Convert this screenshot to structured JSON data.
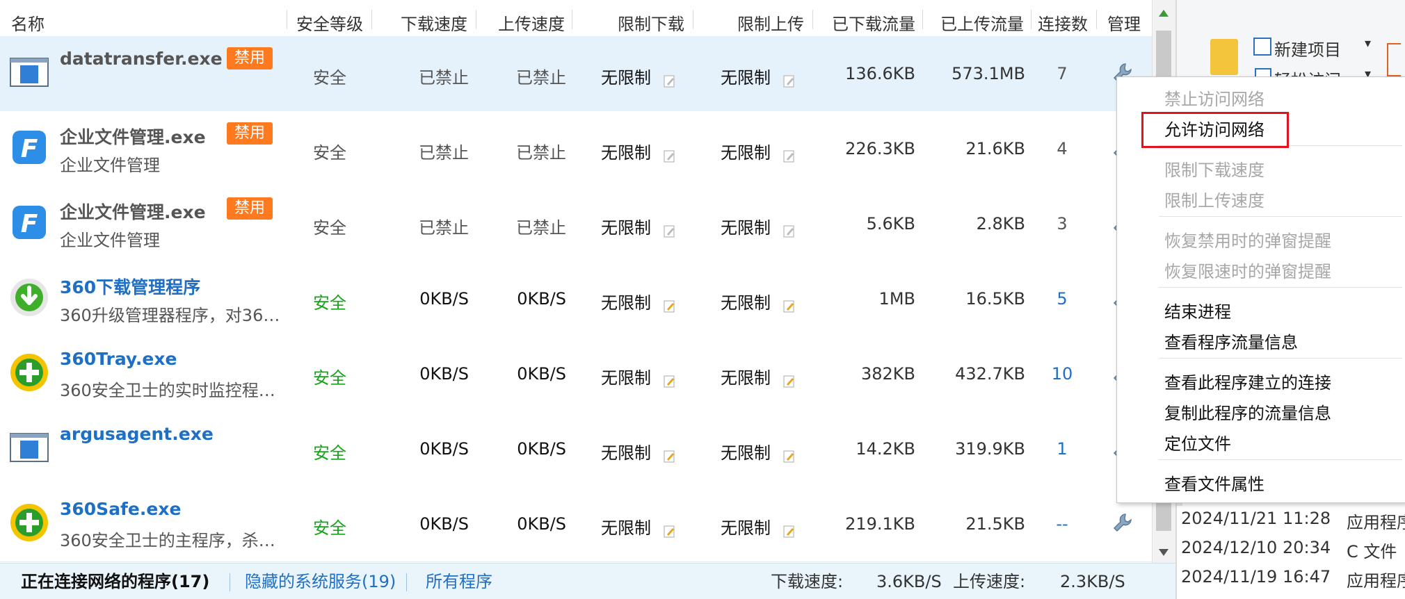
{
  "columns": [
    "名称",
    "安全等级",
    "下载速度",
    "上传速度",
    "限制下载",
    "限制上传",
    "已下载流量",
    "已上传流量",
    "连接数",
    "管理"
  ],
  "rows": [
    {
      "name": "datatransfer.exe",
      "desc": "",
      "badge": "禁用",
      "icon": "window-app-icon",
      "name_color": "gray",
      "security": "安全",
      "security_color": "gray",
      "down_speed": "已禁止",
      "up_speed": "已禁止",
      "limit_down": "无限制",
      "limit_up": "无限制",
      "downloaded": "136.6KB",
      "uploaded": "573.1MB",
      "connections": "7",
      "selected": true
    },
    {
      "name": "企业文件管理.exe",
      "desc": "企业文件管理",
      "badge": "禁用",
      "icon": "blue-f-app-icon",
      "name_color": "gray",
      "security": "安全",
      "security_color": "gray",
      "down_speed": "已禁止",
      "up_speed": "已禁止",
      "limit_down": "无限制",
      "limit_up": "无限制",
      "downloaded": "226.3KB",
      "uploaded": "21.6KB",
      "connections": "4",
      "selected": false
    },
    {
      "name": "企业文件管理.exe",
      "desc": "企业文件管理",
      "badge": "禁用",
      "icon": "blue-f-app-icon",
      "name_color": "gray",
      "security": "安全",
      "security_color": "gray",
      "down_speed": "已禁止",
      "up_speed": "已禁止",
      "limit_down": "无限制",
      "limit_up": "无限制",
      "downloaded": "5.6KB",
      "uploaded": "2.8KB",
      "connections": "3",
      "selected": false
    },
    {
      "name": "360下载管理程序",
      "desc": "360升级管理器程序，对36…",
      "badge": "",
      "icon": "green-download-icon",
      "name_color": "blue",
      "security": "安全",
      "security_color": "green",
      "down_speed": "0KB/S",
      "up_speed": "0KB/S",
      "limit_down": "无限制",
      "limit_up": "无限制",
      "downloaded": "1MB",
      "uploaded": "16.5KB",
      "connections": "5",
      "selected": false
    },
    {
      "name": "360Tray.exe",
      "desc": "360安全卫士的实时监控程…",
      "badge": "",
      "icon": "360-plus-icon",
      "name_color": "blue",
      "security": "安全",
      "security_color": "green",
      "down_speed": "0KB/S",
      "up_speed": "0KB/S",
      "limit_down": "无限制",
      "limit_up": "无限制",
      "downloaded": "382KB",
      "uploaded": "432.7KB",
      "connections": "10",
      "selected": false
    },
    {
      "name": "argusagent.exe",
      "desc": "",
      "badge": "",
      "icon": "window-app-icon",
      "name_color": "blue",
      "security": "安全",
      "security_color": "green",
      "down_speed": "0KB/S",
      "up_speed": "0KB/S",
      "limit_down": "无限制",
      "limit_up": "无限制",
      "downloaded": "14.2KB",
      "uploaded": "319.9KB",
      "connections": "1",
      "selected": false
    },
    {
      "name": "360Safe.exe",
      "desc": "360安全卫士的主程序，杀…",
      "badge": "",
      "icon": "360-plus-icon",
      "name_color": "blue",
      "security": "安全",
      "security_color": "green",
      "down_speed": "0KB/S",
      "up_speed": "0KB/S",
      "limit_down": "无限制",
      "limit_up": "无限制",
      "downloaded": "219.1KB",
      "uploaded": "21.5KB",
      "connections": "--",
      "selected": false
    }
  ],
  "footer": {
    "tab_connecting": "正在连接网络的程序(17)",
    "tab_hidden": "隐藏的系统服务(19)",
    "tab_all": "所有程序",
    "download_label": "下载速度:",
    "download_value": "3.6KB/S",
    "upload_label": "上传速度:",
    "upload_value": "2.3KB/S"
  },
  "context_menu": [
    {
      "label": "禁止访问网络",
      "enabled": false
    },
    {
      "label": "允许访问网络",
      "enabled": true,
      "highlighted": true
    },
    {
      "label": "限制下载速度",
      "enabled": false
    },
    {
      "label": "限制上传速度",
      "enabled": false
    },
    {
      "label": "恢复禁用时的弹窗提醒",
      "enabled": false
    },
    {
      "label": "恢复限速时的弹窗提醒",
      "enabled": false
    },
    {
      "label": "结束进程",
      "enabled": true
    },
    {
      "label": "查看程序流量信息",
      "enabled": true
    },
    {
      "label": "查看此程序建立的连接",
      "enabled": true
    },
    {
      "label": "复制此程序的流量信息",
      "enabled": true
    },
    {
      "label": "定位文件",
      "enabled": true
    },
    {
      "label": "查看文件属性",
      "enabled": true
    }
  ],
  "explorer": {
    "new_item": "新建项目",
    "easy_access": "轻松访问",
    "files": [
      {
        "date": "2024/11/21 11:28",
        "type": "应用程序"
      },
      {
        "date": "2024/12/10 20:34",
        "type": "C 文件"
      },
      {
        "date": "2024/11/19 16:47",
        "type": "应用程序"
      }
    ]
  },
  "colors": {
    "badge": "#ff7a1f",
    "selected_row": "#e6f2fb",
    "link_blue": "#1f6fc4",
    "safe_green": "#18a31a",
    "menu_highlight_border": "#e0121d"
  }
}
